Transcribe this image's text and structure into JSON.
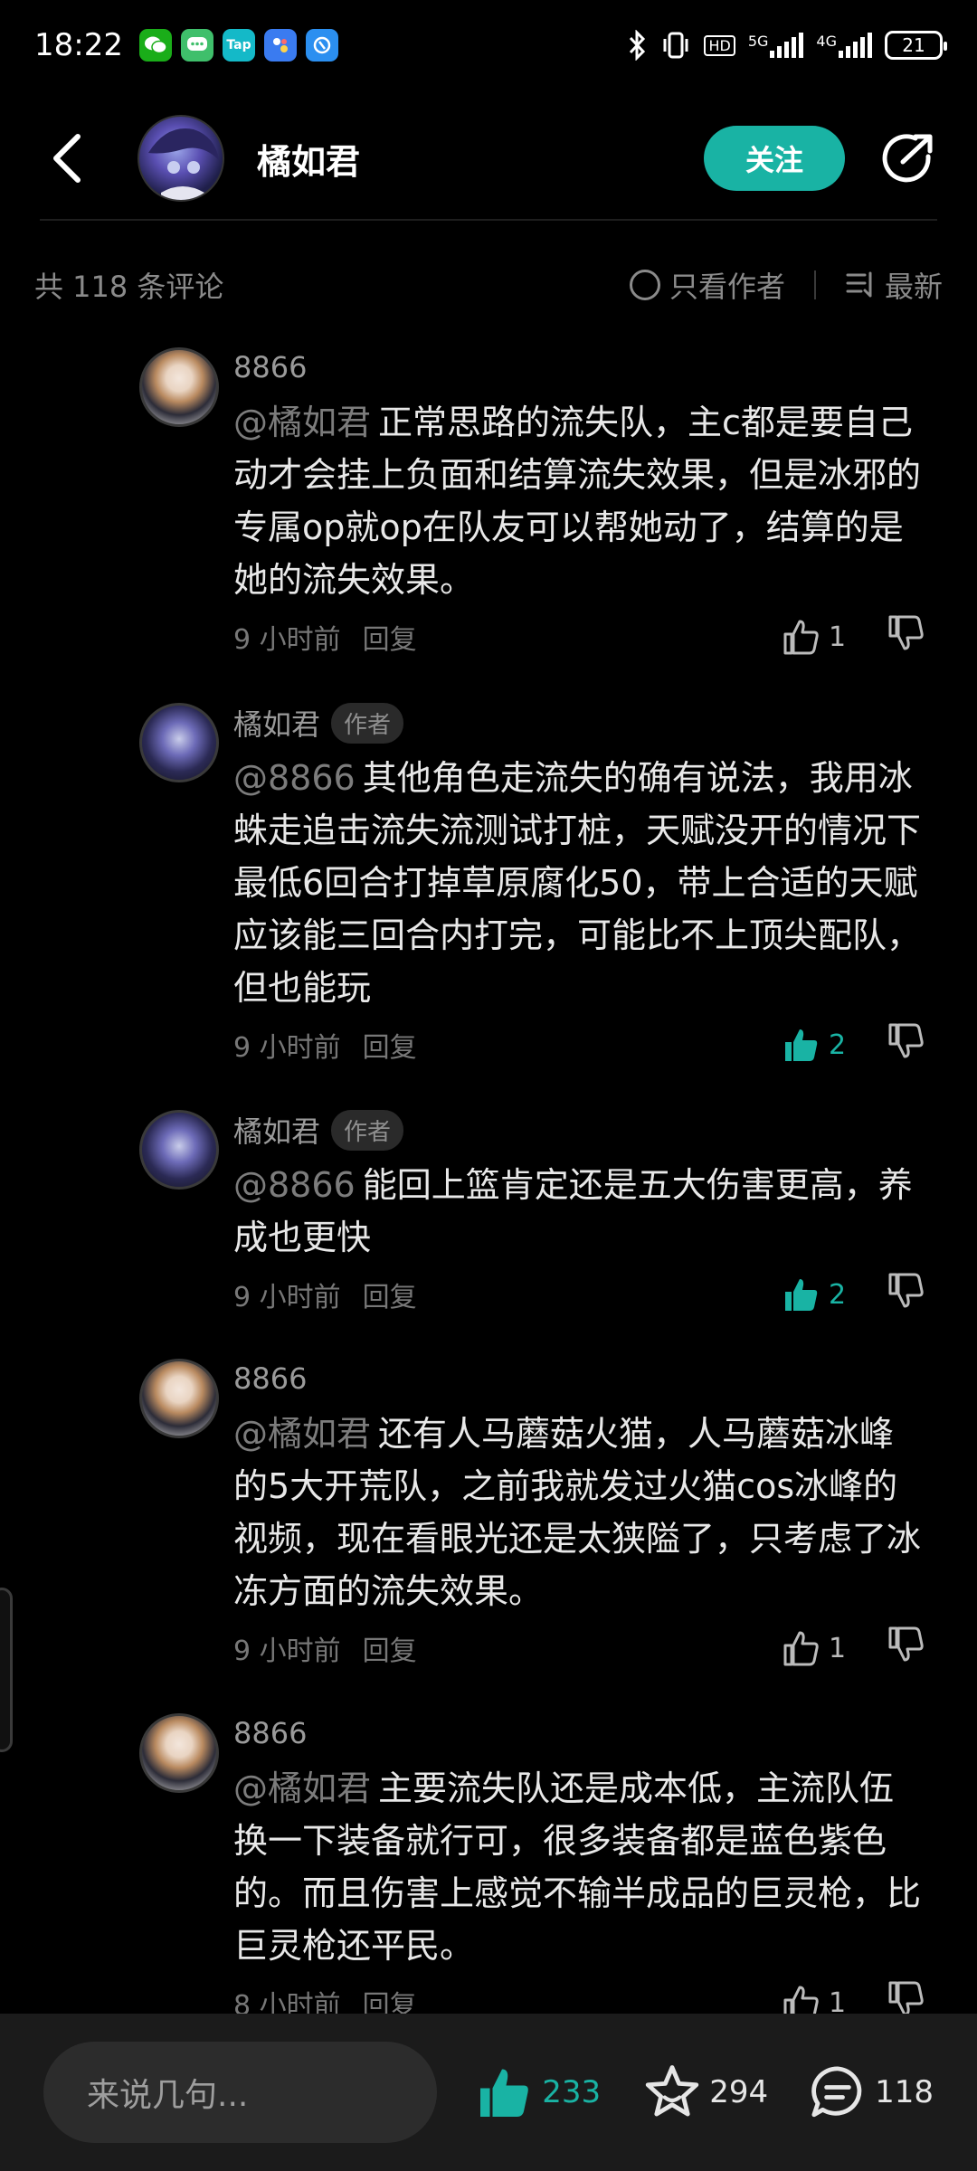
{
  "status_bar": {
    "time": "18:22",
    "apps": [
      {
        "icon": "wechat-icon",
        "color": "#1aad19",
        "label": ""
      },
      {
        "icon": "messages-icon",
        "color": "#3fbf6b",
        "label": ""
      },
      {
        "icon": "taptap-icon",
        "color": "#14b9c8",
        "label": "Tap"
      },
      {
        "icon": "game-icon",
        "color": "#3a7bf0",
        "label": ""
      },
      {
        "icon": "app-icon",
        "color": "#2b8ff0",
        "label": ""
      }
    ],
    "network": "5G",
    "network2": "4G",
    "hd": "HD",
    "battery": "21"
  },
  "header": {
    "title": "橘如君",
    "follow_label": "关注"
  },
  "sort_bar": {
    "total": "共 118 条评论",
    "author_only": "只看作者",
    "sort": "最新"
  },
  "comments": [
    {
      "author": "8866",
      "is_author": false,
      "badge": "",
      "mention": "@橘如君",
      "text": "正常思路的流失队，主c都是要自己动才会挂上负面和结算流失效果，但是冰邪的专属op就op在队友可以帮她动了，结算的是她的流失效果。",
      "time": "9 小时前",
      "reply": "回复",
      "likes": "1",
      "liked": false
    },
    {
      "author": "橘如君",
      "is_author": true,
      "badge": "作者",
      "mention": "@8866",
      "text": "其他角色走流失的确有说法，我用冰蛛走追击流失流测试打桩，天赋没开的情况下最低6回合打掉草原腐化50，带上合适的天赋应该能三回合内打完，可能比不上顶尖配队，但也能玩",
      "time": "9 小时前",
      "reply": "回复",
      "likes": "2",
      "liked": true
    },
    {
      "author": "橘如君",
      "is_author": true,
      "badge": "作者",
      "mention": "@8866",
      "text": "能回上篮肯定还是五大伤害更高，养成也更快",
      "time": "9 小时前",
      "reply": "回复",
      "likes": "2",
      "liked": true
    },
    {
      "author": "8866",
      "is_author": false,
      "badge": "",
      "mention": "@橘如君",
      "text": "还有人马蘑菇火猫，人马蘑菇冰峰的5大开荒队，之前我就发过火猫cos冰峰的视频，现在看眼光还是太狭隘了，只考虑了冰冻方面的流失效果。",
      "time": "9 小时前",
      "reply": "回复",
      "likes": "1",
      "liked": false
    },
    {
      "author": "8866",
      "is_author": false,
      "badge": "",
      "mention": "@橘如君",
      "text": "主要流失队还是成本低，主流队伍换一下装备就行可，很多装备都是蓝色紫色的。而且伤害上感觉不输半成品的巨灵枪，比巨灵枪还平民。",
      "time": "8 小时前",
      "reply": "回复",
      "likes": "1",
      "liked": false
    }
  ],
  "bottom_bar": {
    "input_placeholder": "来说几句...",
    "likes": "233",
    "favorites": "294",
    "comments": "118"
  },
  "colors": {
    "accent": "#19b3a4",
    "background": "#000000"
  }
}
